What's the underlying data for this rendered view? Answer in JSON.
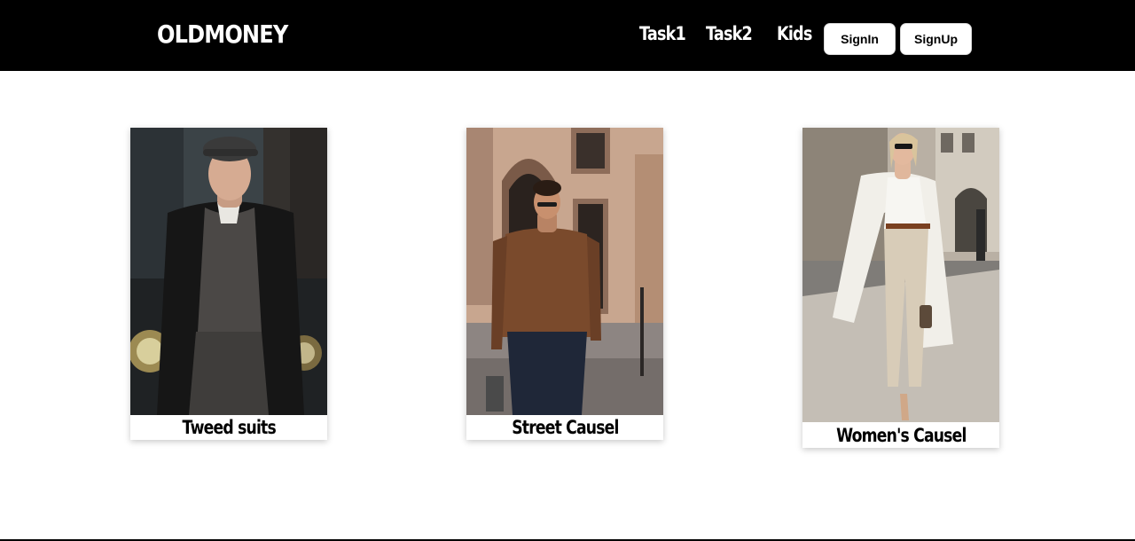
{
  "header": {
    "logo": "OLDMONEY",
    "nav": [
      "Task1",
      "Task2",
      "Kids"
    ],
    "signin_label": "SignIn",
    "signup_label": "SignUp"
  },
  "cards": [
    {
      "caption": "Tweed suits",
      "image": "man-in-tweed-suit-and-flat-cap-photo"
    },
    {
      "caption": "Street Causel",
      "image": "man-in-brown-shirt-street-photo"
    },
    {
      "caption": "Women's Causel",
      "image": "woman-in-white-coat-street-photo"
    }
  ],
  "colors": {
    "header_bg": "#000000",
    "header_text": "#ffffff",
    "button_bg": "#ffffff",
    "page_bg": "#ffffff"
  }
}
